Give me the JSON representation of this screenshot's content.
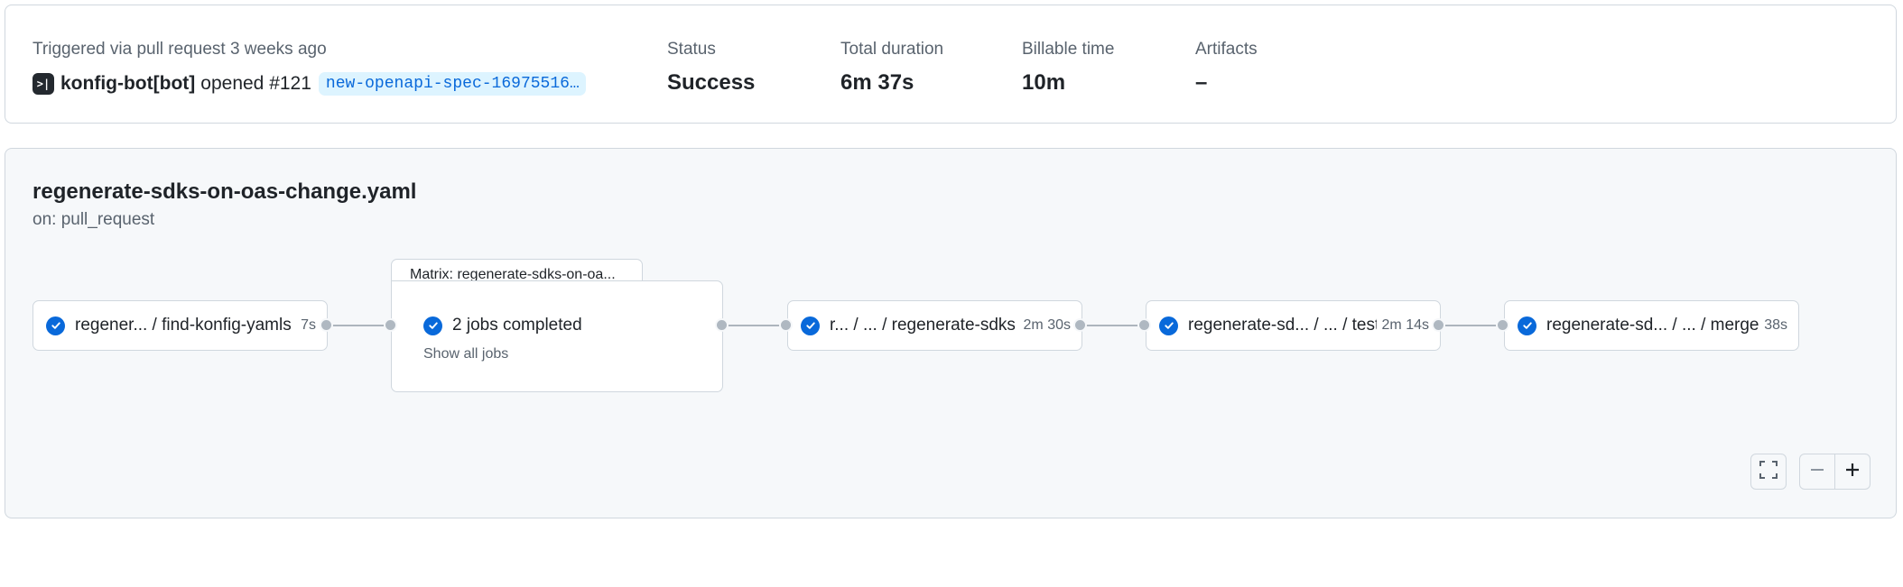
{
  "summary": {
    "trigger_label": "Triggered via pull request 3 weeks ago",
    "actor": "konfig-bot[bot]",
    "action": "opened #121",
    "branch": "new-openapi-spec-16975516…",
    "stats": [
      {
        "label": "Status",
        "value": "Success"
      },
      {
        "label": "Total duration",
        "value": "6m 37s"
      },
      {
        "label": "Billable time",
        "value": "10m"
      },
      {
        "label": "Artifacts",
        "value": "–"
      }
    ]
  },
  "workflow": {
    "file": "regenerate-sdks-on-oas-change.yaml",
    "trigger": "on: pull_request"
  },
  "jobs": [
    {
      "name": "regener... / find-konfig-yamls",
      "duration": "7s",
      "status": "success"
    },
    {
      "name": "r... / ... / regenerate-sdks",
      "duration": "2m 30s",
      "status": "success"
    },
    {
      "name": "regenerate-sd... / ... / test",
      "duration": "2m 14s",
      "status": "success"
    },
    {
      "name": "regenerate-sd... / ... / merge",
      "duration": "38s",
      "status": "success"
    }
  ],
  "matrix": {
    "tab_label": "Matrix: regenerate-sdks-on-oa...",
    "summary": "2 jobs completed",
    "link": "Show all jobs"
  },
  "controls": {
    "fullscreen_icon": "fullscreen-icon",
    "zoom_out_icon": "zoom-out-icon",
    "zoom_in_icon": "zoom-in-icon"
  },
  "colors": {
    "success": "#0969da",
    "border": "#d0d7de",
    "panel_bg": "#f6f8fa",
    "branch_bg": "#ddf4ff"
  }
}
